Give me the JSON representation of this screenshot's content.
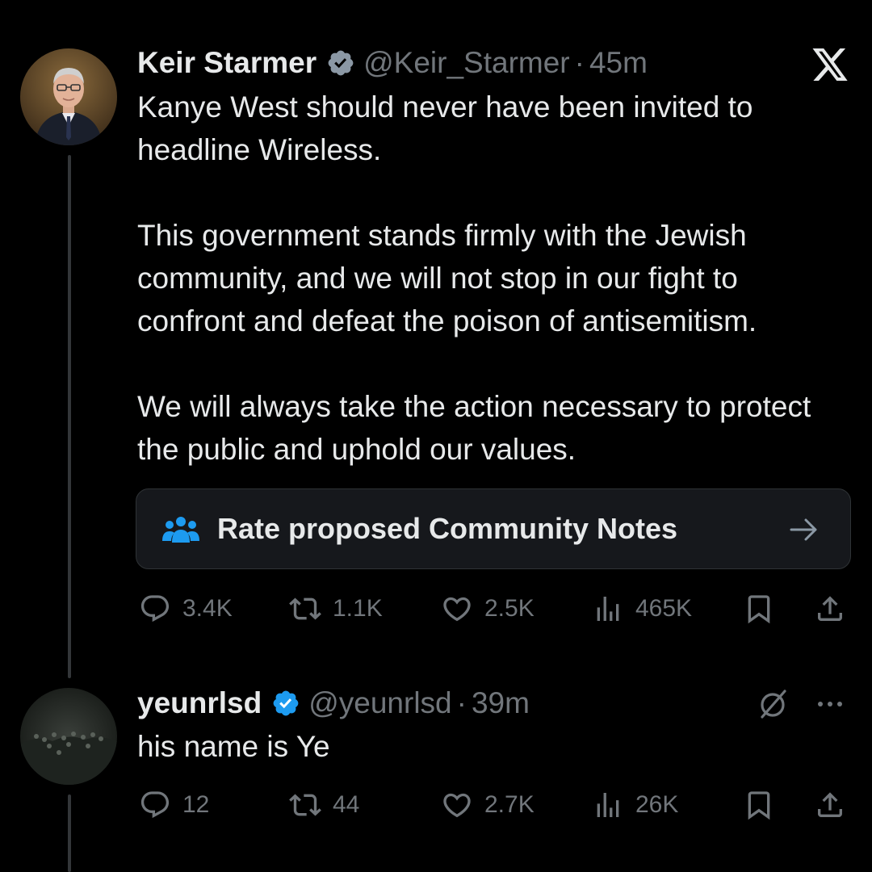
{
  "colors": {
    "background": "#000000",
    "text_primary": "#e7e9ea",
    "text_secondary": "#71767b",
    "verified_blue": "#1d9bf0",
    "notes_box_bg": "#16181c"
  },
  "tweet": {
    "avatar_icon": "profile-photo",
    "name": "Keir Starmer",
    "handle": "@Keir_Starmer",
    "separator": "·",
    "time": "45m",
    "paragraphs": [
      "Kanye West should never have been invited to headline Wireless.",
      "This government stands firmly with the Jewish community, and we will not stop in our fight to confront and defeat the poison of antisemitism.",
      "We will always take the action necessary to protect the public and uphold our values."
    ],
    "community_notes_label": "Rate proposed Community Notes",
    "stats": {
      "replies": "3.4K",
      "reposts": "1.1K",
      "likes": "2.5K",
      "views": "465K"
    }
  },
  "reply": {
    "avatar_icon": "profile-photo",
    "name": "yeunrlsd",
    "handle": "@yeunrlsd",
    "separator": "·",
    "time": "39m",
    "text": "his name is Ye",
    "stats": {
      "replies": "12",
      "reposts": "44",
      "likes": "2.7K",
      "views": "26K"
    }
  }
}
